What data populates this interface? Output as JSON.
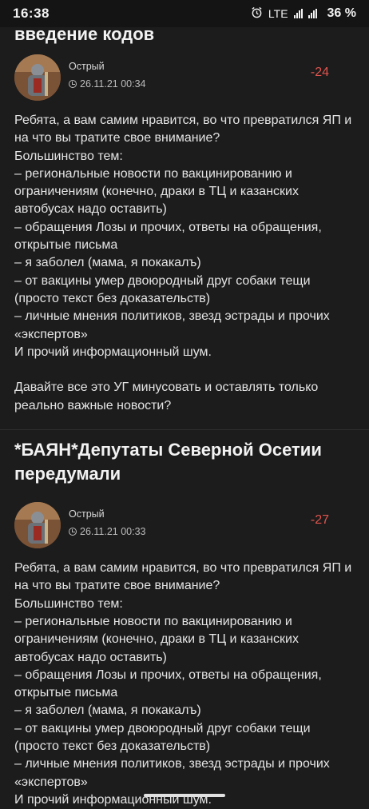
{
  "status_bar": {
    "time": "16:38",
    "network": "LTE",
    "battery": "36 %"
  },
  "posts": [
    {
      "title": "введение кодов",
      "author": "Острый",
      "date": "26.11.21 00:34",
      "rating": "-24",
      "body": "Ребята, а вам самим нравится, во что превратился ЯП и на что вы тратите свое внимание?\nБольшинство тем:\n– региональные новости по вакцинированию и ограничениям (конечно, драки в ТЦ и казанских автобусах надо оставить)\n– обращения Лозы и прочих, ответы на обращения, открытые письма\n– я заболел (мама, я покакалъ)\n– от вакцины умер двоюродный друг собаки тещи (просто текст без доказательств)\n– личные мнения политиков, звезд эстрады и прочих «экспертов»\nИ прочий информационный шум.\n\nДавайте все это УГ минусовать и оставлять только реально важные новости?"
    },
    {
      "title": "*БАЯН*Депутаты Северной Осетии передумали",
      "author": "Острый",
      "date": "26.11.21 00:33",
      "rating": "-27",
      "body": "Ребята, а вам самим нравится, во что превратился ЯП и на что вы тратите свое внимание?\nБольшинство тем:\n– региональные новости по вакцинированию и ограничениям (конечно, драки в ТЦ и казанских автобусах надо оставить)\n– обращения Лозы и прочих, ответы на обращения, открытые письма\n– я заболел (мама, я покакалъ)\n– от вакцины умер двоюродный друг собаки тещи (просто текст без доказательств)\n– личные мнения политиков, звезд эстрады и прочих «экспертов»\nИ прочий информационный шум."
    }
  ],
  "colors": {
    "background": "#1c1c1c",
    "rating_negative": "#e0554f"
  }
}
